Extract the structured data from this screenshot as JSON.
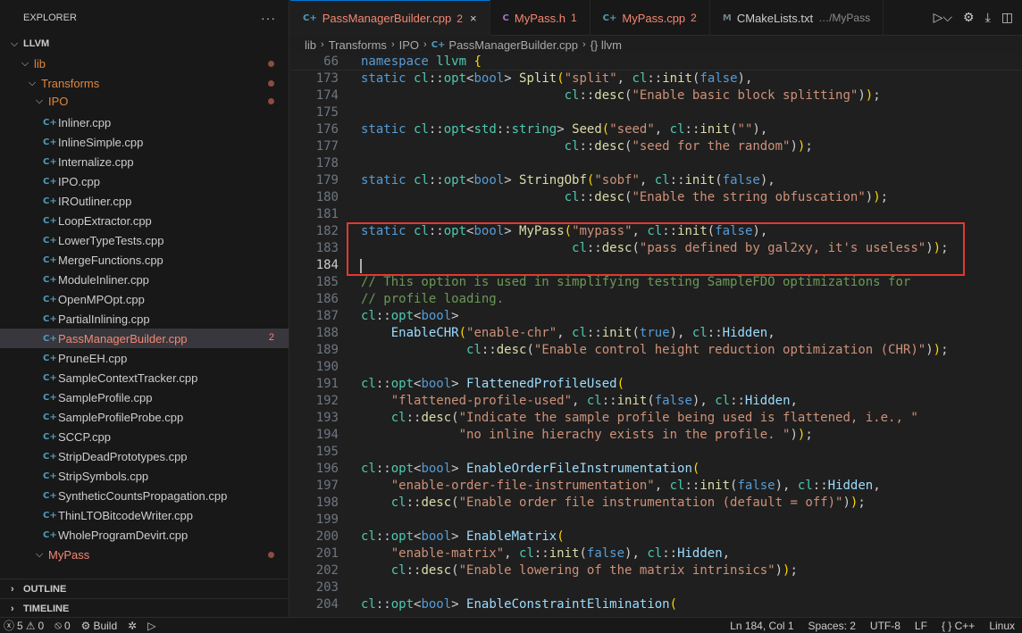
{
  "sidebar": {
    "title": "EXPLORER",
    "more": "···",
    "root": "LLVM",
    "lib": "lib",
    "transforms": "Transforms",
    "ipo": "IPO",
    "files": [
      "Inliner.cpp",
      "InlineSimple.cpp",
      "Internalize.cpp",
      "IPO.cpp",
      "IROutliner.cpp",
      "LoopExtractor.cpp",
      "LowerTypeTests.cpp",
      "MergeFunctions.cpp",
      "ModuleInliner.cpp",
      "OpenMPOpt.cpp",
      "PartialInlining.cpp",
      "PassManagerBuilder.cpp",
      "PruneEH.cpp",
      "SampleContextTracker.cpp",
      "SampleProfile.cpp",
      "SampleProfileProbe.cpp",
      "SCCP.cpp",
      "StripDeadPrototypes.cpp",
      "StripSymbols.cpp",
      "SyntheticCountsPropagation.cpp",
      "ThinLTOBitcodeWriter.cpp",
      "WholeProgramDevirt.cpp"
    ],
    "selected_file_count": "2",
    "mypass_folder": "MyPass",
    "outline": "OUTLINE",
    "timeline": "TIMELINE"
  },
  "tabs": [
    {
      "icon": "C+",
      "name": "PassManagerBuilder.cpp",
      "count": "2",
      "close": "×"
    },
    {
      "icon": "C",
      "name": "MyPass.h",
      "count": "1"
    },
    {
      "icon": "C+",
      "name": "MyPass.cpp",
      "count": "2"
    },
    {
      "icon": "M",
      "name": "CMakeLists.txt",
      "path": "…/MyPass"
    }
  ],
  "breadcrumb": [
    "lib",
    "Transforms",
    "IPO",
    "PassManagerBuilder.cpp",
    "{} llvm"
  ],
  "code": {
    "sticky_line": "66",
    "sticky_text": "namespace llvm {",
    "line_numbers": [
      "173",
      "174",
      "175",
      "176",
      "177",
      "178",
      "179",
      "180",
      "181",
      "182",
      "183",
      "184",
      "185",
      "186",
      "187",
      "188",
      "189",
      "190",
      "191",
      "192",
      "193",
      "194",
      "195",
      "196",
      "197",
      "198",
      "199",
      "200",
      "201",
      "202",
      "203",
      "204"
    ],
    "current_line": "184"
  },
  "status": {
    "errors": "5",
    "warnings": "0",
    "ports": "0",
    "build": "Build",
    "position": "Ln 184, Col 1",
    "spaces": "Spaces: 2",
    "encoding": "UTF-8",
    "eol": "LF",
    "language": "{ } C++",
    "platform": "Linux"
  },
  "colors": {
    "accent": "#0078d4",
    "error": "#f48771",
    "highlight_box": "#e03a2e"
  }
}
